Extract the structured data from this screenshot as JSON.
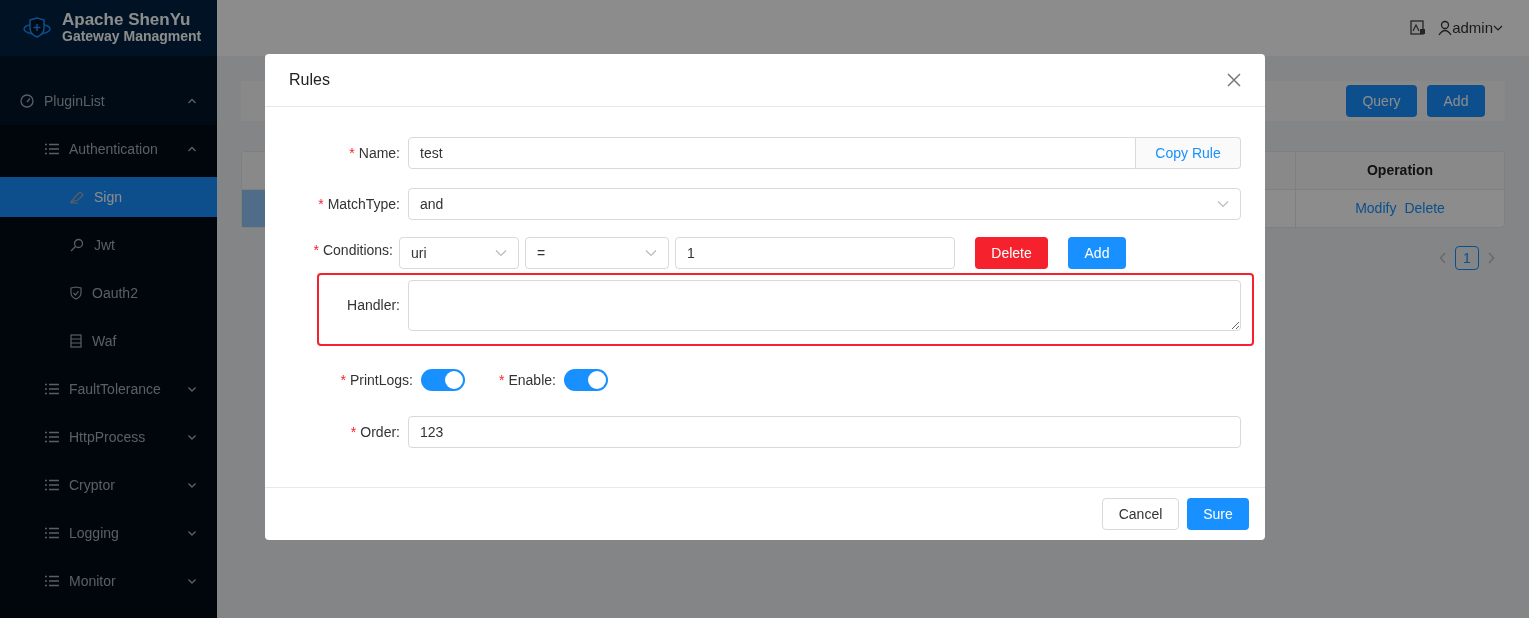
{
  "sidebar": {
    "logo": {
      "title": "Apache ShenYu",
      "subtitle": "Gateway Managment"
    },
    "menu": [
      {
        "label": "PluginList",
        "expanded": true,
        "children": [
          {
            "label": "Authentication",
            "expanded": true,
            "children": [
              {
                "label": "Sign",
                "selected": true
              },
              {
                "label": "Jwt",
                "selected": false
              },
              {
                "label": "Oauth2",
                "selected": false
              },
              {
                "label": "Waf",
                "selected": false
              }
            ]
          },
          {
            "label": "FaultTolerance",
            "expanded": false
          },
          {
            "label": "HttpProcess",
            "expanded": false
          },
          {
            "label": "Cryptor",
            "expanded": false
          },
          {
            "label": "Logging",
            "expanded": false
          },
          {
            "label": "Monitor",
            "expanded": false
          }
        ]
      }
    ]
  },
  "header": {
    "user": "admin"
  },
  "page": {
    "search_buttons": [
      "Query",
      "Add"
    ],
    "table": {
      "columns": [
        "Operation"
      ],
      "rows": [
        {
          "selected": true,
          "actions": [
            "Modify",
            "Delete"
          ]
        }
      ]
    },
    "pagination": [
      {
        "label": "1",
        "selected": true
      }
    ]
  },
  "modal": {
    "title": "Rules",
    "fields": [
      {
        "kind": "text",
        "label": "Name:",
        "mark": "*",
        "value": "test",
        "addon": "Copy Rule"
      },
      {
        "kind": "select",
        "label": "MatchType:",
        "mark": "*",
        "value": "and"
      },
      {
        "kind": "conditions",
        "label": "Conditions:",
        "mark": "*",
        "param_type": "uri",
        "operator": "=",
        "value": "1",
        "buttons": [
          "Delete",
          "Add"
        ]
      },
      {
        "kind": "textarea",
        "label": "Handler:",
        "highlighted": true
      },
      {
        "kind": "switches",
        "items": [
          {
            "label": "PrintLogs:",
            "mark": "*",
            "on": true
          },
          {
            "label": "Enable:",
            "mark": "*",
            "on": true
          }
        ]
      },
      {
        "kind": "text",
        "label": "Order:",
        "mark": "*",
        "value": "123"
      }
    ],
    "footer": [
      {
        "kind": "default",
        "label": "Cancel"
      },
      {
        "kind": "primary",
        "label": "Sure"
      }
    ]
  }
}
